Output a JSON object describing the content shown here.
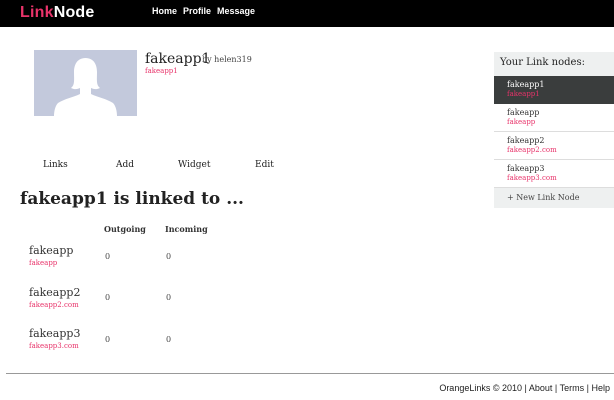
{
  "header": {
    "logo_part1": "Link",
    "logo_part2": "Node",
    "nav": [
      "Home",
      "Profile",
      "Message"
    ]
  },
  "profile": {
    "name": "fakeapp1",
    "by": "by helen319",
    "url": "fakeapp1"
  },
  "actions": [
    "Links",
    "Add",
    "Widget",
    "Edit"
  ],
  "linked": {
    "heading": "fakeapp1 is linked to ...",
    "columns": [
      "Outgoing",
      "Incoming"
    ],
    "rows": [
      {
        "name": "fakeapp",
        "url": "fakeapp",
        "outgoing": "0",
        "incoming": "0"
      },
      {
        "name": "fakeapp2",
        "url": "fakeapp2.com",
        "outgoing": "0",
        "incoming": "0"
      },
      {
        "name": "fakeapp3",
        "url": "fakeapp3.com",
        "outgoing": "0",
        "incoming": "0"
      }
    ]
  },
  "sidebar": {
    "title": "Your Link nodes:",
    "items": [
      {
        "name": "fakeapp1",
        "url": "fakeapp1"
      },
      {
        "name": "fakeapp",
        "url": "fakeapp"
      },
      {
        "name": "fakeapp2",
        "url": "fakeapp2.com"
      },
      {
        "name": "fakeapp3",
        "url": "fakeapp3.com"
      }
    ],
    "new_link": "+ New Link Node"
  },
  "footer": {
    "copyright": "OrangeLinks © 2010",
    "sep": "|",
    "links": [
      "About",
      "Terms",
      "Help"
    ]
  },
  "colors": {
    "accent": "#e8336a",
    "topbar": "#000000",
    "active_item": "#3a3d3d",
    "avatar_bg": "#c3c9dc"
  },
  "icons": {
    "avatar": "default-person-silhouette-icon"
  }
}
